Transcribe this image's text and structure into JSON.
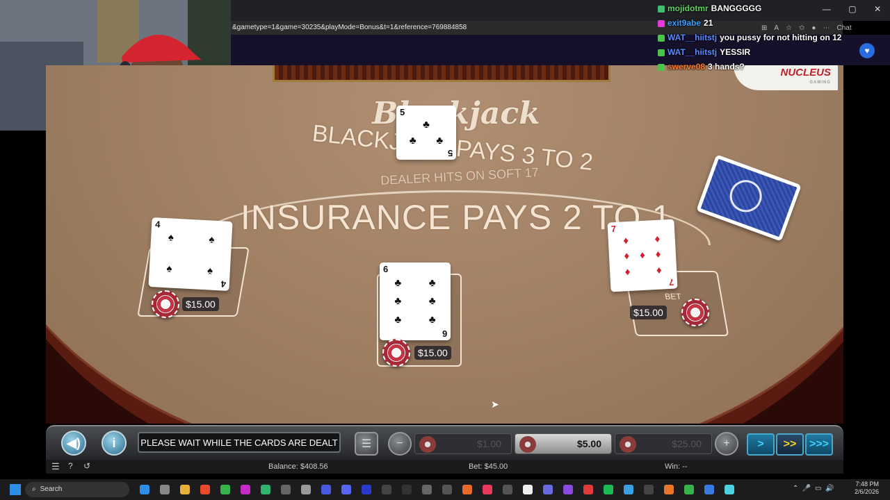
{
  "browser": {
    "url": "&gametype=1&game=30235&playMode=Bonus&t=1&reference=769884858",
    "chat_button_label": "Chat"
  },
  "game": {
    "title": "Blackjack",
    "blackjack_pays": "BLACKJACK PAYS 3 TO 2",
    "dealer_rule": "DEALER HITS ON SOFT 17",
    "insurance": "INSURANCE PAYS 2 TO 1",
    "brand": "NUCLEUS",
    "brand_sub": "GAMING",
    "dealer_card": {
      "rank": "5",
      "suit": "♣"
    },
    "hands": [
      {
        "rank": "4",
        "suit": "♠",
        "bet": "$15.00",
        "color": "black"
      },
      {
        "rank": "6",
        "suit": "♣",
        "bet": "$15.00",
        "color": "black"
      },
      {
        "rank": "7",
        "suit": "♦",
        "bet": "$15.00",
        "color": "red"
      }
    ],
    "bet_spot_text": "BET",
    "message": "PLEASE WAIT WHILE THE CARDS ARE DEALT",
    "chips": [
      {
        "label": "$1.00",
        "active": false
      },
      {
        "label": "$5.00",
        "active": true
      },
      {
        "label": "$25.00",
        "active": false
      }
    ],
    "balance": "Balance: $408.56",
    "bet": "Bet: $45.00",
    "win": "Win: --",
    "sound_icon": "speaker-icon",
    "info_icon": "info-icon"
  },
  "chat": [
    {
      "user": "mojidotmr",
      "msg": "BANGGGGG",
      "color": "#5fd35f"
    },
    {
      "user": "exit9abe",
      "msg": "21",
      "color": "#3aa0ff"
    },
    {
      "user": "WAT__hiitstj",
      "msg": "you pussy for not hitting on 12",
      "color": "#5b8bff"
    },
    {
      "user": "WAT__hiitstj",
      "msg": "YESSIR",
      "color": "#5b8bff"
    },
    {
      "user": "swerve08",
      "msg": "3 hands?",
      "color": "#ff7a2a"
    }
  ],
  "taskbar": {
    "search_label": "Search",
    "time": "7:48 PM",
    "date": "2/6/2026"
  }
}
